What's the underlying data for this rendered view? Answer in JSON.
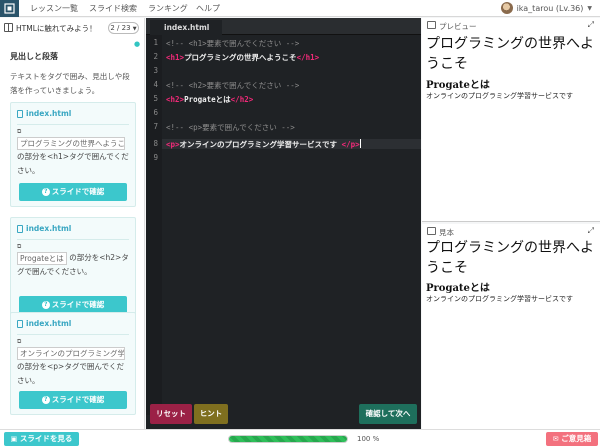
{
  "nav": {
    "items": [
      "レッスン一覧",
      "スライド検索",
      "ランキング",
      "ヘルプ"
    ],
    "user": "ika_tarou (Lv.36)"
  },
  "lesson": {
    "title": "HTMLに触れてみよう！",
    "pager": "2 / 23",
    "section_title": "見出しと段落",
    "description": "テキストをタグで囲み、見出しや段落を作っていきましょう。",
    "cards": [
      {
        "file": "index.html",
        "snippet": "プログラミングの世界へようこそ",
        "instruction": "の部分を<h1>タグで囲んでください。",
        "button": "スライドで確認"
      },
      {
        "file": "index.html",
        "snippet": "Progateとは",
        "instruction": "の部分を<h2>タグで囲んでください。",
        "button": "スライドで確認"
      },
      {
        "file": "index.html",
        "snippet": "オンラインのプログラミング学習サービスです",
        "instruction": "の部分を<p>タグで囲んでください。",
        "button": "スライドで確認"
      }
    ]
  },
  "editor": {
    "tab": "index.html",
    "lines": [
      {
        "n": "1",
        "comment": "<!-- <h1>要素で囲んでください -->"
      },
      {
        "n": "2",
        "open": "<h1>",
        "text": "プログラミングの世界へようこそ",
        "close": "</h1>"
      },
      {
        "n": "3"
      },
      {
        "n": "4",
        "comment": "<!-- <h2>要素で囲んでください -->"
      },
      {
        "n": "5",
        "open": "<h2>",
        "text": "Progateとは",
        "close": "</h2>"
      },
      {
        "n": "6"
      },
      {
        "n": "7",
        "comment": "<!-- <p>要素で囲んでください -->"
      },
      {
        "n": "8",
        "open": "<p>",
        "text": "オンラインのプログラミング学習サービスです ",
        "close": "</p>"
      },
      {
        "n": "9"
      }
    ],
    "reset_label": "リセット",
    "hint_label": "ヒント",
    "next_label": "確認して次へ"
  },
  "preview": {
    "label": "プレビュー",
    "h1": "プログラミングの世界へようこそ",
    "h2": "Progateとは",
    "p": "オンラインのプログラミング学習サービスです"
  },
  "answer": {
    "label": "見本",
    "h1": "プログラミングの世界へようこそ",
    "h2": "Progateとは",
    "p": "オンラインのプログラミング学習サービスです"
  },
  "bottom": {
    "slide_button": "スライドを見る",
    "progress": 100,
    "progress_label": "100 %",
    "feedback_button": "ご意見箱"
  },
  "colors": {
    "accent": "#3cc7cc",
    "tag": "#f02a78",
    "reset": "#9b2146",
    "hint": "#7f6f1f",
    "next": "#1e6f5c",
    "feedback": "#f3717e"
  }
}
